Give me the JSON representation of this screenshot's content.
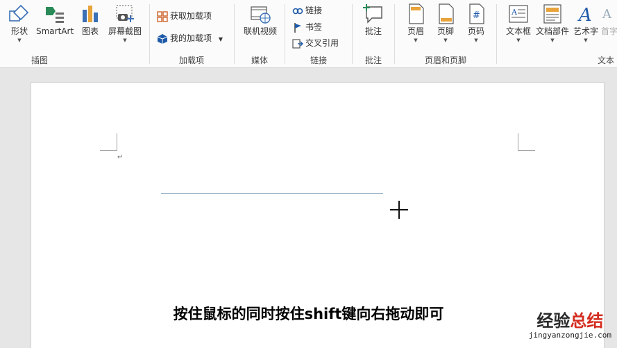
{
  "ribbon": {
    "groups": {
      "illustrations": {
        "label": "插图",
        "shapes": "形状",
        "smartart": "SmartArt",
        "chart": "图表",
        "screenshot": "屏幕截图"
      },
      "addins": {
        "label": "加载项",
        "get_addins": "获取加载项",
        "my_addins": "我的加载项"
      },
      "media": {
        "label": "媒体",
        "online_video": "联机视频"
      },
      "links": {
        "label": "链接",
        "link": "链接",
        "bookmark": "书签",
        "cross_reference": "交叉引用"
      },
      "comments": {
        "label": "批注",
        "comment": "批注"
      },
      "header_footer": {
        "label": "页眉和页脚",
        "header": "页眉",
        "footer": "页脚",
        "page_number": "页码"
      },
      "text": {
        "label": "文本",
        "text_box": "文本框",
        "quick_parts": "文档部件",
        "wordart": "艺术字",
        "drop_cap": "首字"
      }
    }
  },
  "document": {
    "paragraph_mark": "↵"
  },
  "video_subtitle": "按住鼠标的同时按住shift键向右拖动即可",
  "watermark": {
    "main_a": "经验",
    "main_b": "总结",
    "sub": "jingyanzongjie.com"
  },
  "colors": {
    "accent_blue": "#2b579a",
    "drawn_line": "#9fb7c9",
    "watermark_red": "#d42b1e"
  }
}
